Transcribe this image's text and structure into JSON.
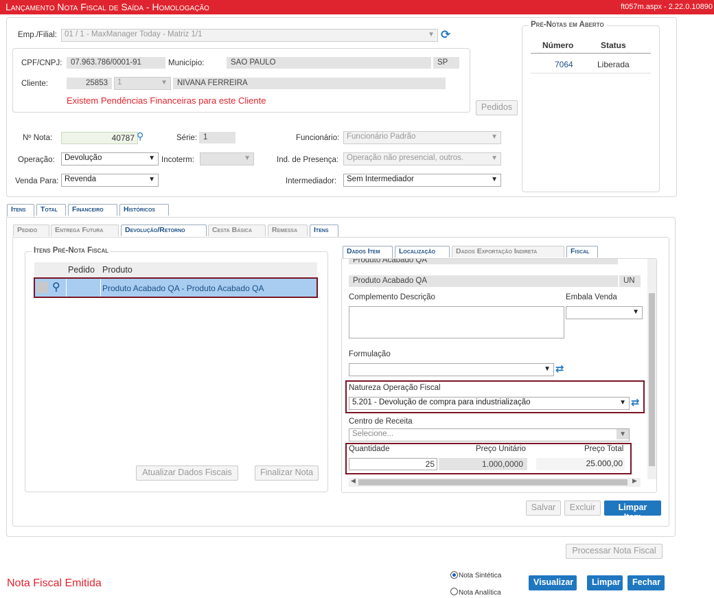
{
  "title": "Lançamento Nota Fiscal de Saída  - Homologação",
  "page_info": "ft057m.aspx - 2.22.0.10890",
  "header": {
    "emp_label": "Emp./Filial:",
    "emp_value": "01 / 1 - MaxManager Today - Matriz 1/1",
    "cpf_label": "CPF/CNPJ:",
    "cpf_value": "07.963.786/0001-91",
    "municipio_label": "Município:",
    "municipio_value": "SAO PAULO",
    "uf_value": "SP",
    "cliente_label": "Cliente:",
    "cliente_code": "25853",
    "cliente_seq": "1",
    "cliente_name": "NIVANA FERREIRA",
    "pendencia": "Existem Pendências Financeiras para este Cliente",
    "pedidos_button": "Pedidos"
  },
  "prenotas": {
    "title": "Pré-Notas em Aberto",
    "col_numero": "Número",
    "col_status": "Status",
    "rows": [
      {
        "numero": "7064",
        "status": "Liberada"
      }
    ]
  },
  "nota": {
    "num_label": "Nº Nota:",
    "num_value": "40787",
    "serie_label": "Série:",
    "serie_value": "1",
    "func_label": "Funcionário:",
    "func_value": "Funcionário Padrão",
    "oper_label": "Operação:",
    "oper_value": "Devolução",
    "incoterm_label": "Incoterm:",
    "presenca_label": "Ind. de Presença:",
    "presenca_value": "Operação não presencial, outros.",
    "venda_label": "Venda Para:",
    "venda_value": "Revenda",
    "interm_label": "Intermediador:",
    "interm_value": "Sem Intermediador"
  },
  "main_tabs": [
    "Itens",
    "Total",
    "Financeiro",
    "Históricos"
  ],
  "sub_tabs": [
    "Pedido",
    "Entrega Futura",
    "Devolução/Retorno",
    "Cesta Básica",
    "Remessa",
    "Itens"
  ],
  "items_group": {
    "title": "Itens Pré-Nota Fiscal",
    "col_pedido": "Pedido",
    "col_produto": "Produto",
    "row_produto": "Produto Acabado QA - Produto Acabado QA",
    "btn_atualizar": "Atualizar Dados Fiscais",
    "btn_finalizar": "Finalizar Nota"
  },
  "detail_tabs": [
    "Dados Item",
    "Localização",
    "Dados Exportação Indireta",
    "Fiscal"
  ],
  "detail": {
    "cut_text": "Produto Acabado QA",
    "produto_desc": "Produto Acabado QA",
    "unidade": "UN",
    "complemento_label": "Complemento Descrição",
    "embala_label": "Embala Venda",
    "formulacao_label": "Formulação",
    "natureza_label": "Natureza Operação Fiscal",
    "natureza_value": "5.201 - Devolução de compra para industrialização",
    "centro_label": "Centro de Receita",
    "centro_placeholder": "Selecione...",
    "qtd_label": "Quantidade",
    "preco_unit_label": "Preço Unitário",
    "preco_total_label": "Preço Total",
    "qtd_value": "25",
    "preco_unit_value": "1.000,0000",
    "preco_total_value": "25.000,00"
  },
  "item_buttons": {
    "salvar": "Salvar",
    "excluir": "Excluir",
    "limpar_item": "Limpar Item"
  },
  "footer": {
    "processar": "Processar Nota Fiscal",
    "status_msg": "Nota Fiscal Emitida",
    "radio_sintetica": "Nota Sintética",
    "radio_analitica": "Nota Analítica",
    "visualizar": "Visualizar",
    "limpar": "Limpar",
    "fechar": "Fechar"
  },
  "colors": {
    "title_bar": "#e0242f",
    "accent": "#1f77c0",
    "alert": "#e0242f",
    "highlight_box": "#7a1424",
    "selected_row": "#a8cdf0"
  }
}
